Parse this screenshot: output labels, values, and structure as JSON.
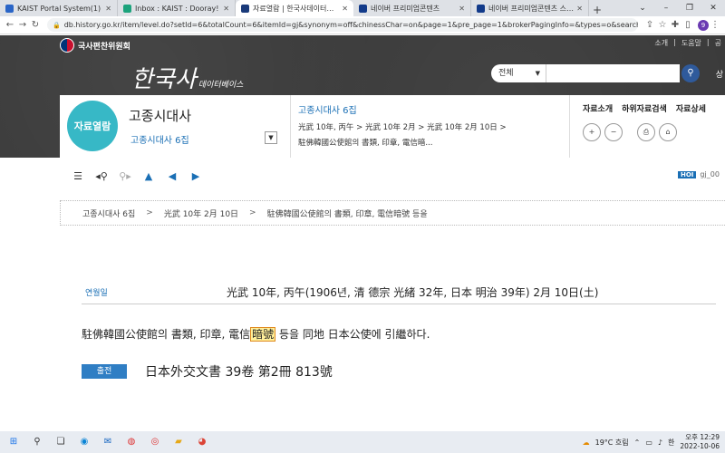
{
  "browser": {
    "tabs": [
      {
        "label": "KAIST Portal System(1)",
        "color": "#2a65c7"
      },
      {
        "label": "Inbox : KAIST : Dooray!",
        "color": "#1ca37c"
      },
      {
        "label": "자료열람 | 한국사데이터베이스",
        "color": "#1a3a7a"
      },
      {
        "label": "네이버 프리미엄콘텐츠",
        "color": "#123a8a"
      },
      {
        "label": "네이버 프리미엄콘텐츠 스튜디오",
        "color": "#123a8a"
      }
    ],
    "new_tab": "+",
    "url": "db.history.go.kr/item/level.do?setId=6&totalCount=6&itemId=gj&synonym=off&chinessChar=on&page=1&pre_page=1&brokerPagingInfo=&types=o&searchSubjectClass=...",
    "profile_initial": "9"
  },
  "site": {
    "gov_name": "국사편찬위원회",
    "top_links": [
      "소개",
      "도움말",
      "공"
    ],
    "logo": "한국사",
    "logo_sub": "데이터베이스",
    "search": {
      "select": "전체"
    },
    "extra": "상"
  },
  "info": {
    "badge": "자료열람",
    "title": "고종시대사",
    "volume": "고종시대사 6집",
    "mid_title": "고종시대사 6집",
    "mid_path": "光武 10年, 丙午  > 光武 10年 2月  > 光武 10年 2月 10日  >",
    "mid_desc": "駐佛韓國公使館의 書類, 印章, 電信暗...",
    "right_links": [
      "자료소개",
      "하위자료검색",
      "자료상세"
    ]
  },
  "toolbar": {
    "hoi_badge": "HOI",
    "hoi_value": "gj_00"
  },
  "breadcrumb": [
    "고종시대사 6집",
    "光武 10年 2月 10日",
    "駐佛韓國公使館의 書類, 印章, 電信暗號 등을"
  ],
  "content": {
    "date_label": "연월일",
    "date_value": "光武 10年, 丙午(1906년, 清 德宗 光緒 32年, 日本 明治 39年) 2月 10日(土)",
    "body_before": "駐佛韓國公使館의 書類, 印章, 電信",
    "body_highlight": "暗號",
    "body_after": " 등을 同地 日本公使에 引繼하다.",
    "source_label": "출전",
    "source_value": "日本外交文書 39卷 第2冊 813號"
  },
  "taskbar": {
    "weather": "19°C 흐림",
    "ime": "한",
    "time": "오후 12:29",
    "date": "2022-10-06"
  }
}
